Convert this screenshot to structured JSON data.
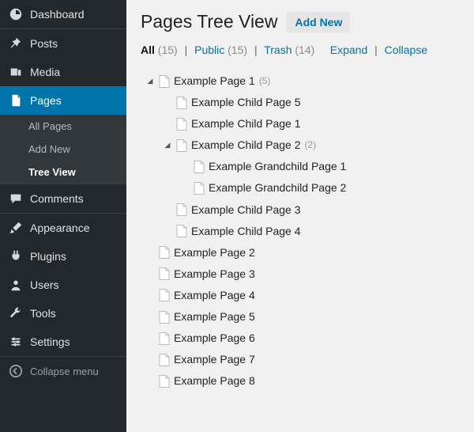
{
  "sidebar": {
    "items": [
      {
        "label": "Dashboard",
        "icon": "dashboard-icon"
      },
      {
        "label": "Posts",
        "icon": "pin-icon"
      },
      {
        "label": "Media",
        "icon": "media-icon"
      },
      {
        "label": "Pages",
        "icon": "pages-icon",
        "active": true
      },
      {
        "label": "Comments",
        "icon": "comment-icon"
      },
      {
        "label": "Appearance",
        "icon": "brush-icon"
      },
      {
        "label": "Plugins",
        "icon": "plug-icon"
      },
      {
        "label": "Users",
        "icon": "user-icon"
      },
      {
        "label": "Tools",
        "icon": "wrench-icon"
      },
      {
        "label": "Settings",
        "icon": "settings-icon"
      }
    ],
    "submenu": [
      {
        "label": "All Pages"
      },
      {
        "label": "Add New"
      },
      {
        "label": "Tree View",
        "current": true
      }
    ],
    "collapse_label": "Collapse menu"
  },
  "header": {
    "title": "Pages Tree View",
    "add_new": "Add New"
  },
  "filters": {
    "all_label": "All",
    "all_count": "(15)",
    "public_label": "Public",
    "public_count": "(15)",
    "trash_label": "Trash",
    "trash_count": "(14)",
    "expand_label": "Expand",
    "collapse_label": "Collapse"
  },
  "tree": [
    {
      "label": "Example Page 1",
      "count": "(5)",
      "expanded": true,
      "children": [
        {
          "label": "Example Child Page 5"
        },
        {
          "label": "Example Child Page 1"
        },
        {
          "label": "Example Child Page 2",
          "count": "(2)",
          "expanded": true,
          "children": [
            {
              "label": "Example Grandchild Page 1"
            },
            {
              "label": "Example Grandchild Page 2"
            }
          ]
        },
        {
          "label": "Example Child Page 3"
        },
        {
          "label": "Example Child Page 4"
        }
      ]
    },
    {
      "label": "Example Page 2"
    },
    {
      "label": "Example Page 3"
    },
    {
      "label": "Example Page 4"
    },
    {
      "label": "Example Page 5"
    },
    {
      "label": "Example Page 6"
    },
    {
      "label": "Example Page 7"
    },
    {
      "label": "Example Page 8"
    }
  ]
}
